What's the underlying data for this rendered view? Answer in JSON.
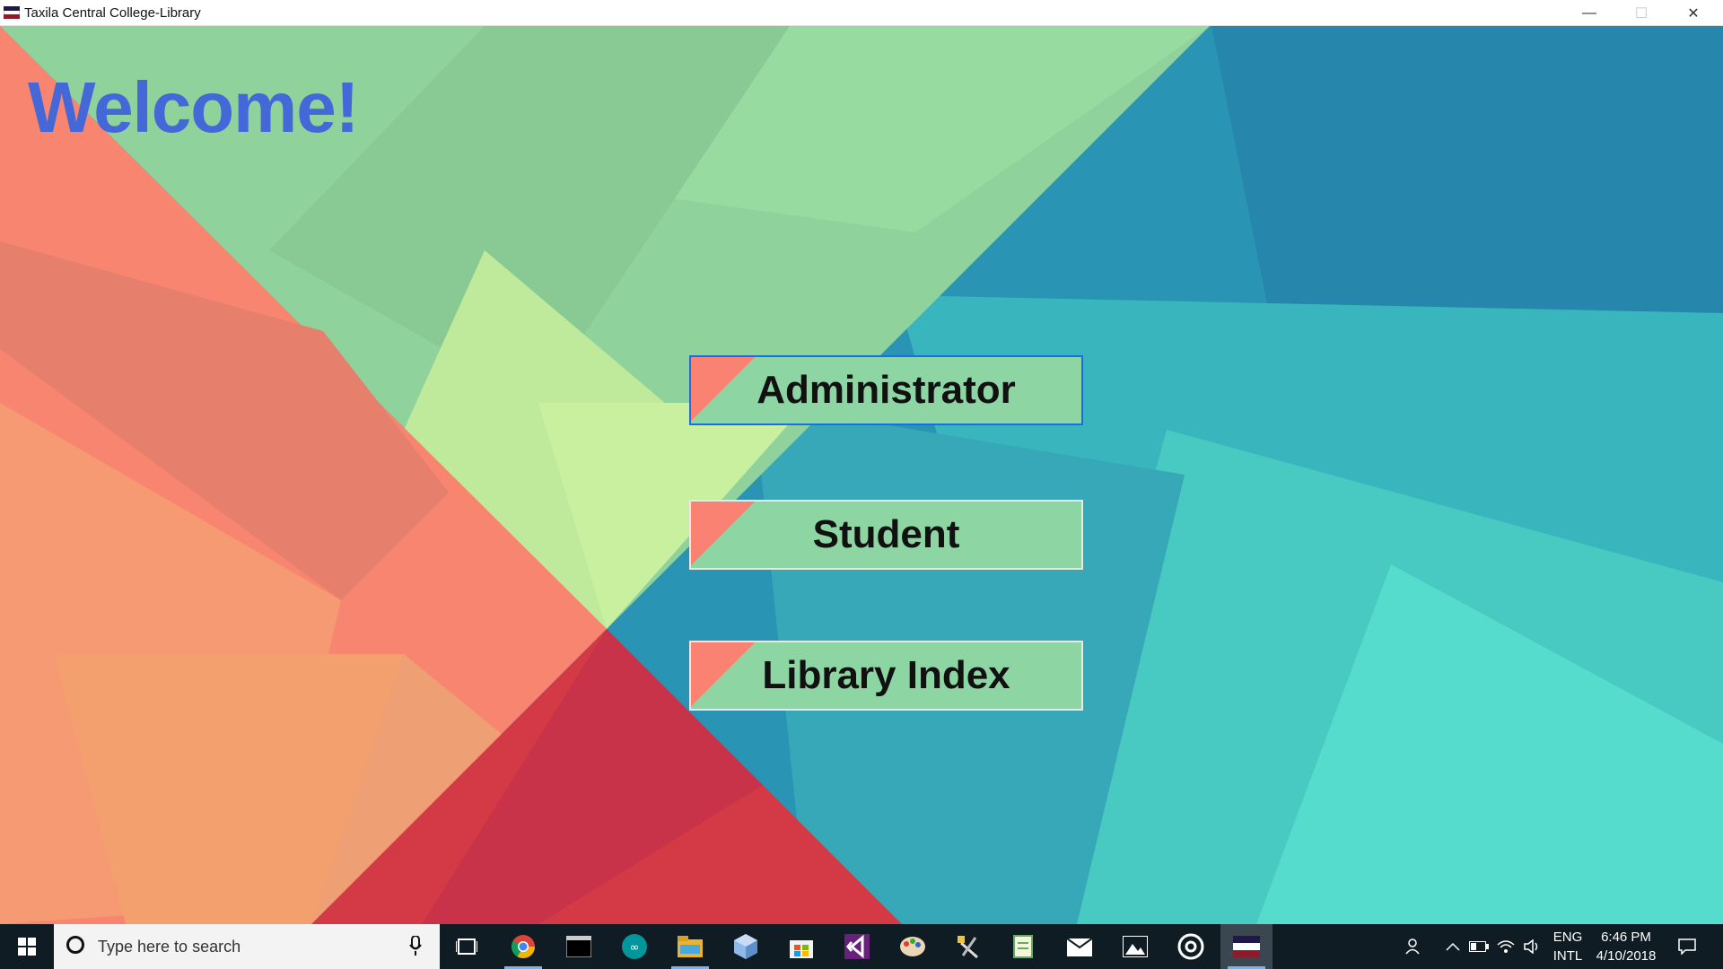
{
  "window": {
    "title": "Taxila Central College-Library",
    "minimize_glyph": "—",
    "maximize_glyph": "☐",
    "close_glyph": "✕"
  },
  "main": {
    "welcome": "Welcome!",
    "buttons": {
      "administrator": "Administrator",
      "student": "Student",
      "library_index": "Library Index"
    }
  },
  "taskbar": {
    "search_placeholder": "Type here to search",
    "pinned": [
      "chrome-icon",
      "terminal-icon",
      "arduino-icon",
      "file-explorer-icon",
      "cube-app-icon",
      "store-icon",
      "visual-studio-icon",
      "paint-icon",
      "tools-icon",
      "notepad-app-icon",
      "mail-icon",
      "photos-icon",
      "media-icon",
      "taxila-app-icon"
    ],
    "language_line1": "ENG",
    "language_line2": "INTL",
    "time": "6:46 PM",
    "date": "4/10/2018"
  },
  "colors": {
    "welcome_text": "#4468d8",
    "button_green": "#8dd5a2",
    "button_coral": "#fa8272",
    "focus_border": "#1570e6",
    "taskbar": "#101c24"
  }
}
